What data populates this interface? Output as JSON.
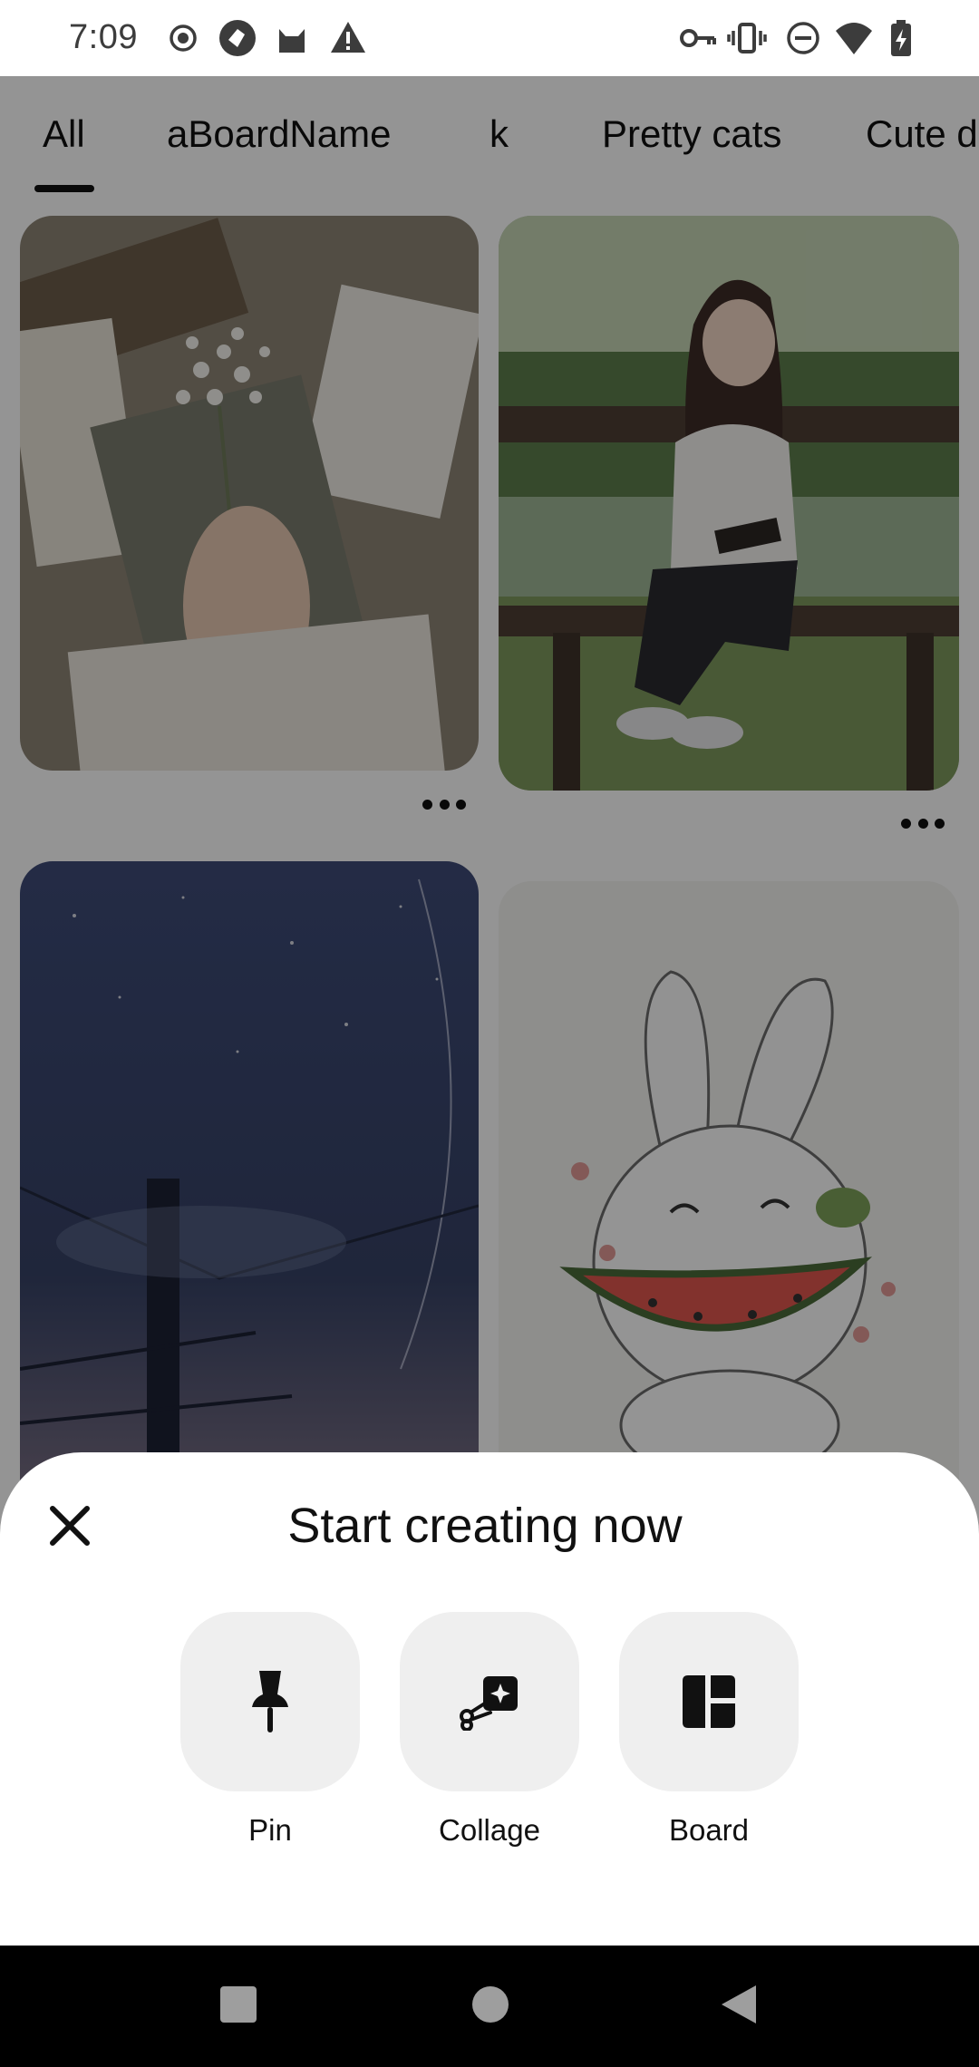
{
  "status_bar": {
    "time": "7:09",
    "left_icons": [
      "record-icon",
      "vpn-shield-icon",
      "cat-app-icon",
      "warning-icon"
    ],
    "right_icons": [
      "key-icon",
      "vibrate-icon",
      "dnd-icon",
      "wifi-icon",
      "battery-charging-icon"
    ]
  },
  "tabs": [
    {
      "label": "All",
      "selected": true
    },
    {
      "label": "aBoardName",
      "selected": false
    },
    {
      "label": "k",
      "selected": false
    },
    {
      "label": "Pretty cats",
      "selected": false
    },
    {
      "label": "Cute d",
      "selected": false
    }
  ],
  "pins": [
    {
      "name": "pin-flowers-book",
      "more": "more-options"
    },
    {
      "name": "pin-anime-girl-bench",
      "more": "more-options"
    },
    {
      "name": "pin-night-sky",
      "more": ""
    },
    {
      "name": "pin-bunny-watermelon",
      "more": ""
    }
  ],
  "sheet": {
    "title": "Start creating now",
    "actions": [
      {
        "label": "Pin",
        "icon": "pushpin-icon"
      },
      {
        "label": "Collage",
        "icon": "scissors-sparkle-icon"
      },
      {
        "label": "Board",
        "icon": "board-grid-icon"
      }
    ]
  },
  "colors": {
    "scrim": "#000000",
    "sheet_bg": "#ffffff",
    "tile_bg": "#efefef",
    "text": "#111111",
    "nav_bar": "#000000"
  }
}
